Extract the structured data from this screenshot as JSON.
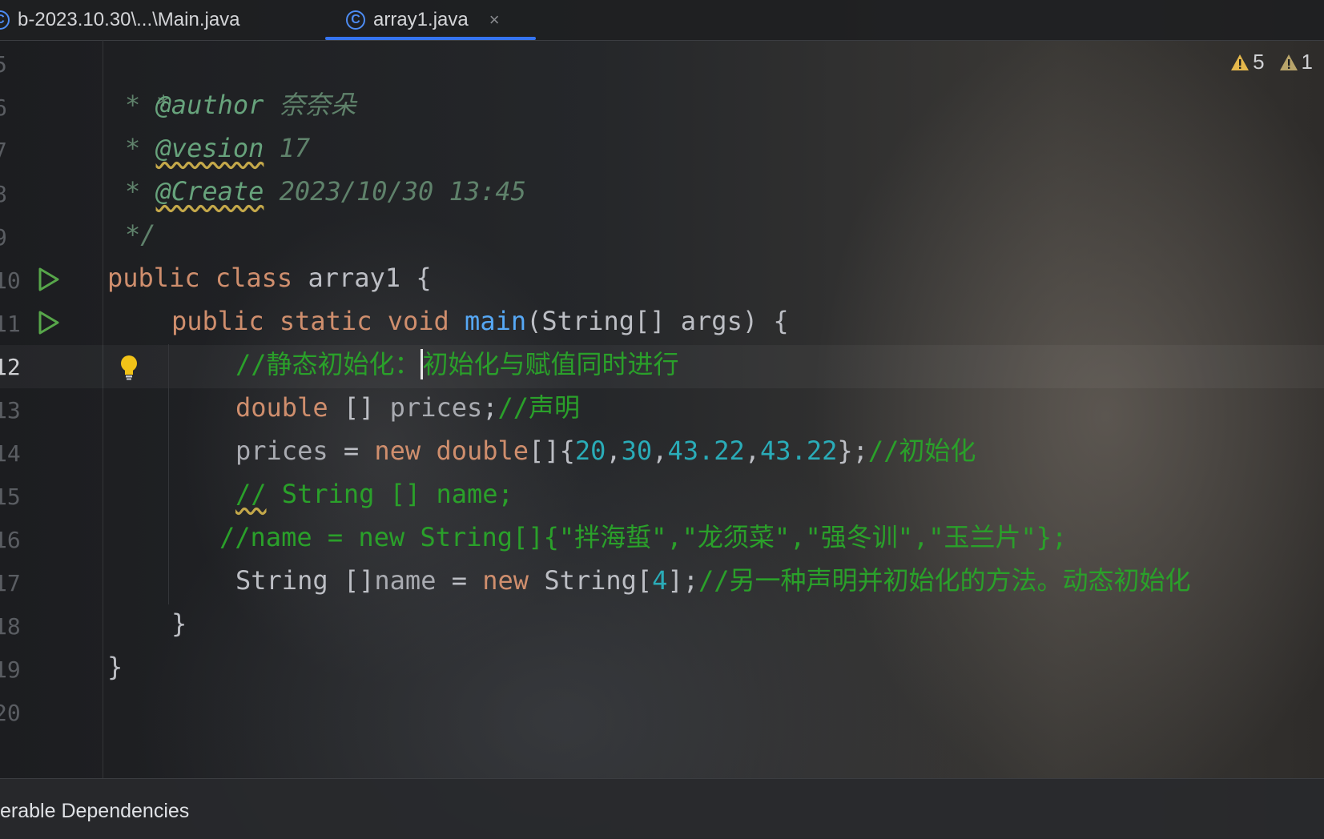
{
  "tabs": [
    {
      "label": "b-2023.10.30\\...\\Main.java"
    },
    {
      "label": "array1.java",
      "icon": "class-icon",
      "close": "×"
    }
  ],
  "inspections": {
    "warnings": "5",
    "weak_warnings": "1"
  },
  "line_numbers": [
    "5",
    "6",
    "7",
    "8",
    "9",
    "10",
    "11",
    "12",
    "13",
    "14",
    "15",
    "16",
    "17",
    "18",
    "19",
    "20"
  ],
  "code": {
    "l5_star": "*",
    "l6_star": "* ",
    "l6_tag": "@author",
    "l6_val": " 奈奈朵",
    "l7_star": "* ",
    "l7_tag": "@vesion",
    "l7_val": " 17",
    "l8_star": "* ",
    "l8_tag": "@Create",
    "l8_val": " 2023/10/30 13:45",
    "l9": "*/",
    "l10_kw": "public class",
    "l10_name": " array1 {",
    "l11_kw": "public static void",
    "l11_fn": " main",
    "l11_rest": "(String[] args) {",
    "l12_a": "//静态初始化：",
    "l12_b": "初始化与赋值同时进行",
    "l13_kw": "double",
    "l13_mid": " [] ",
    "l13_var": "prices",
    "l13_semi": ";",
    "l13_cm": "//声明",
    "l14_var": "prices",
    "l14_eq": " = ",
    "l14_kw": "new double",
    "l14_br": "[]{",
    "l14_n1": "20",
    "l14_n2": "30",
    "l14_n3": "43.22",
    "l14_n4": "43.22",
    "l14_end": "};",
    "l14_cm": "//初始化",
    "l15_slash": "//",
    "l15_rest": " String [] name;",
    "l16": "//name = new String[]{\"拌海蜇\",\"龙须菜\",\"强冬训\",\"玉兰片\"};",
    "l17_a": "String []",
    "l17_var": "name",
    "l17_eq": " = ",
    "l17_kw": "new",
    "l17_b": " String[",
    "l17_n": "4",
    "l17_c": "];",
    "l17_cm": "//另一种声明并初始化的方法。动态初始化",
    "l18": "}",
    "l19": "}"
  },
  "status": {
    "text": "erable Dependencies"
  }
}
